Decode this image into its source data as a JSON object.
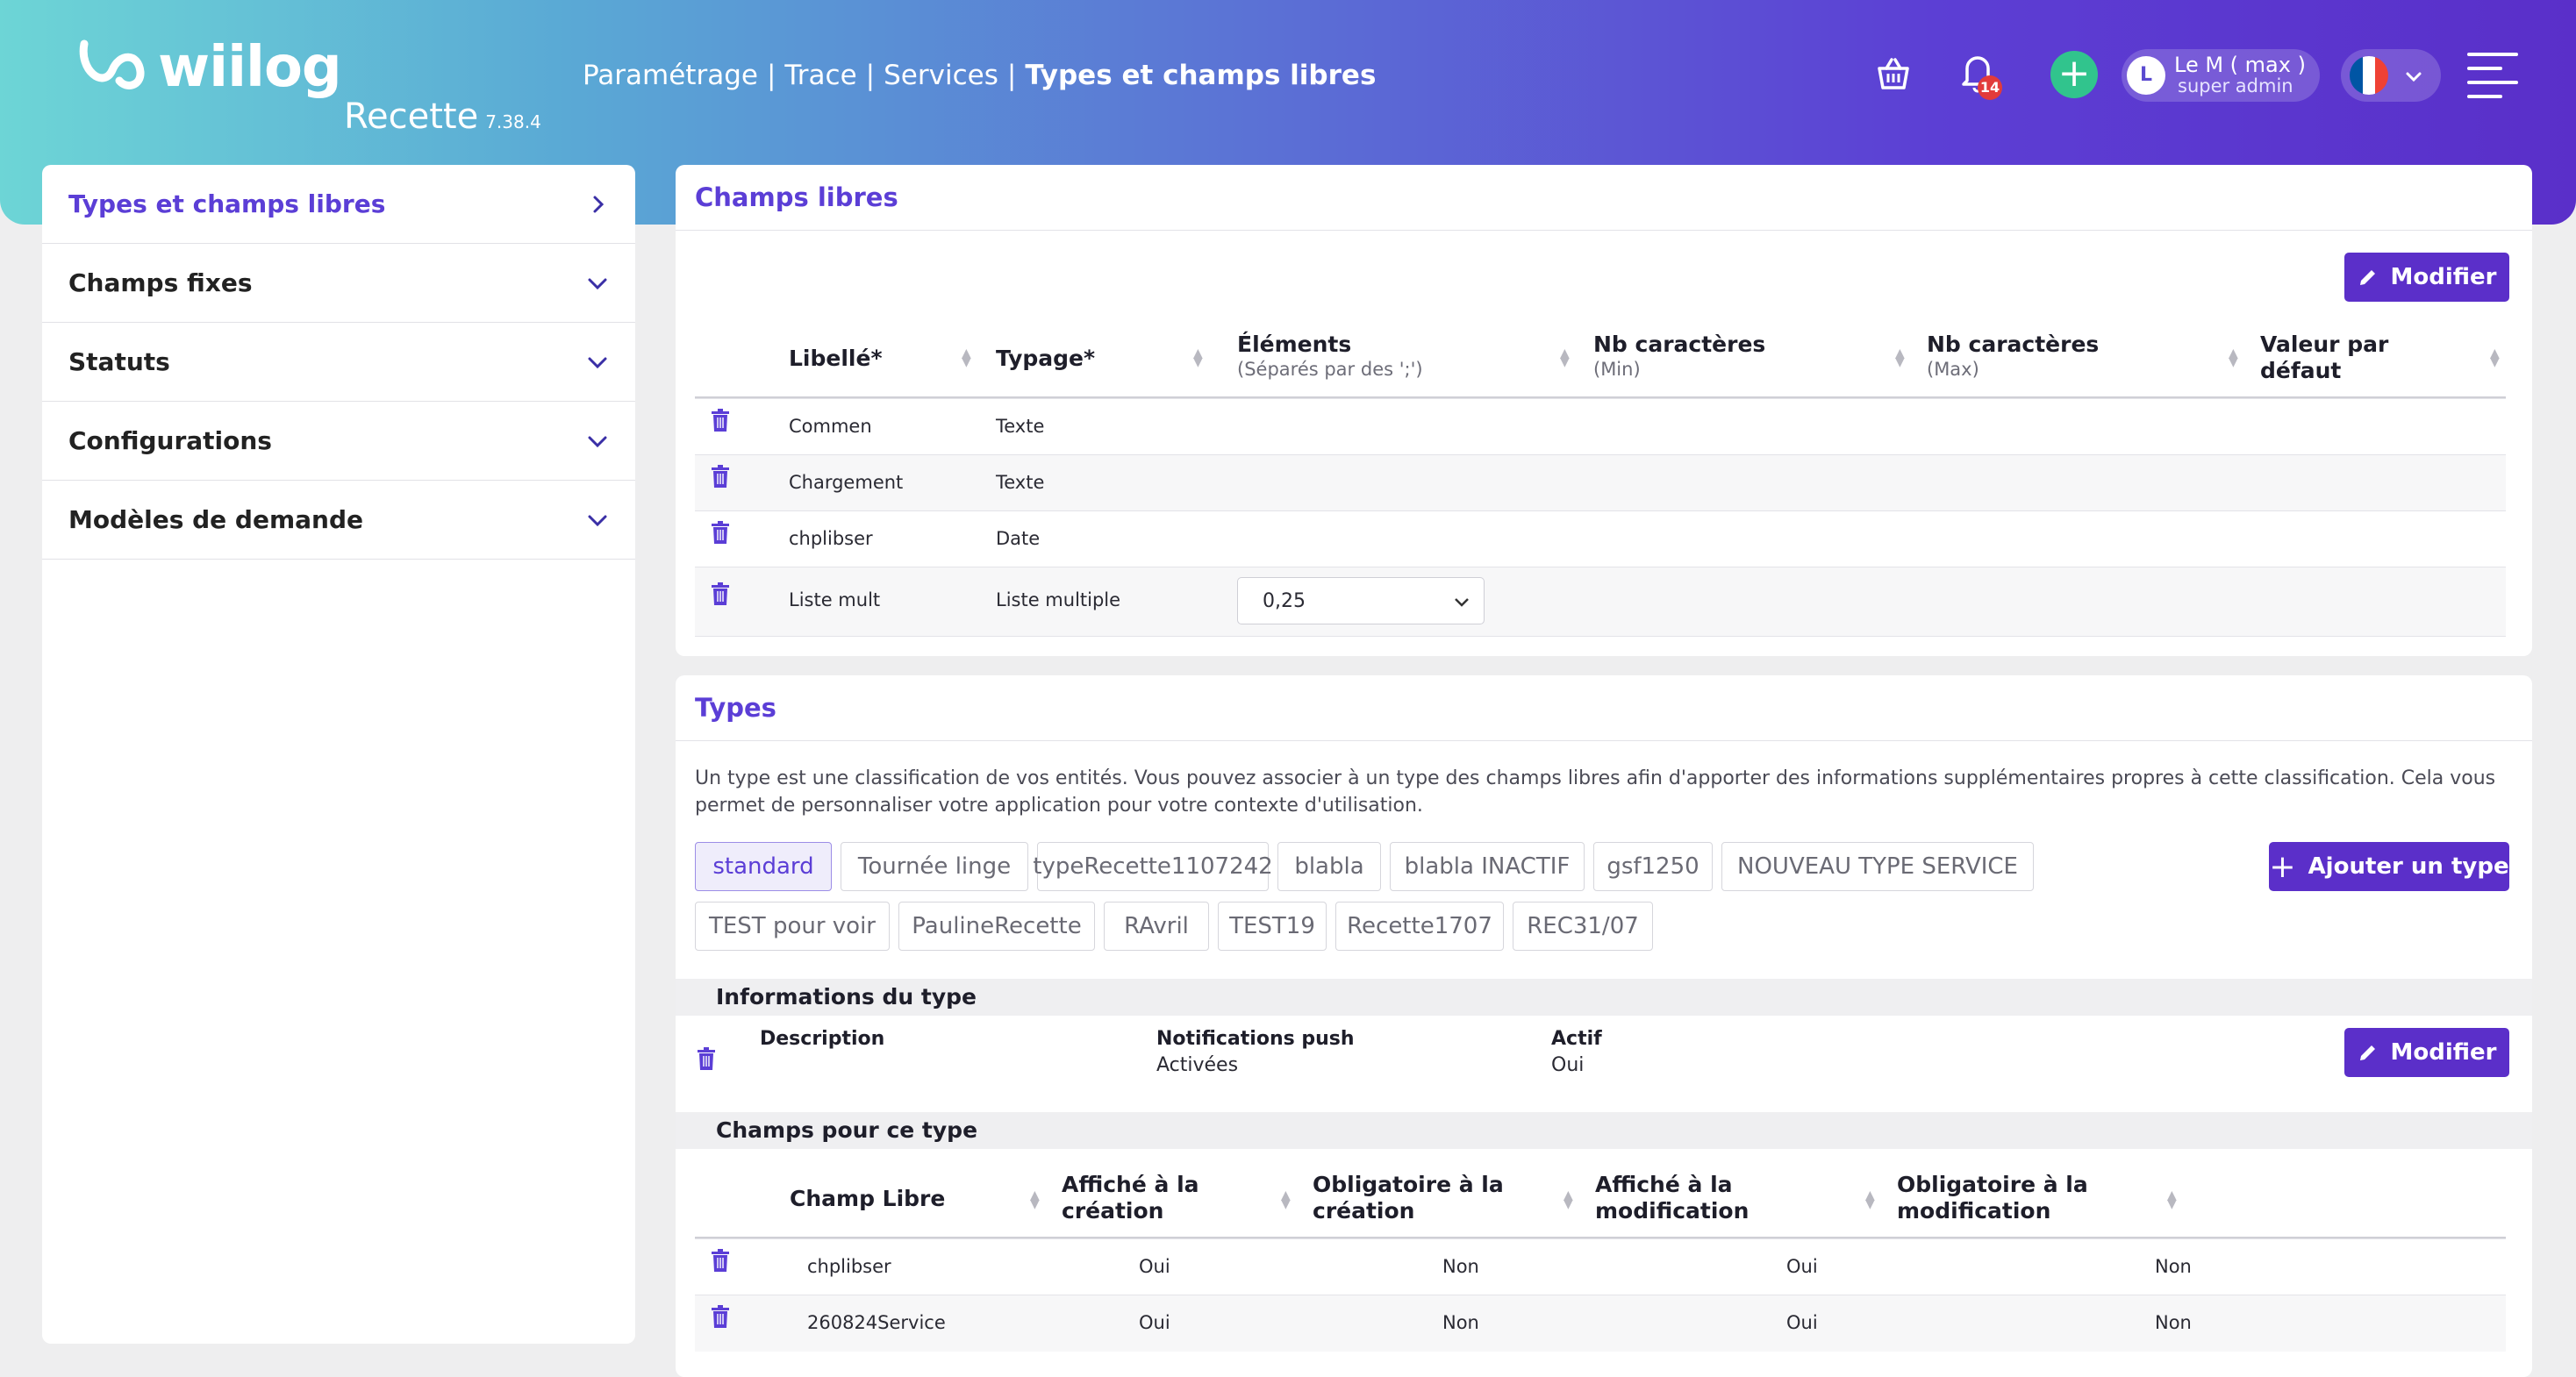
{
  "header": {
    "logo_text": "wiilog",
    "environment": "Recette",
    "version": "7.38.4",
    "breadcrumb": [
      "Paramétrage",
      "Trace",
      "Services",
      "Types et champs libres"
    ],
    "notification_count": "14",
    "user": {
      "initial": "L",
      "name": "Le M ( max )",
      "role": "super admin"
    },
    "language_flag_colors": [
      "#0055a4",
      "#ffffff",
      "#ef4135"
    ],
    "icons": [
      "basket-icon",
      "bell-icon",
      "plus-icon",
      "chevron-down-icon",
      "menu-icon"
    ]
  },
  "sidebar": {
    "items": [
      {
        "label": "Types et champs libres",
        "icon": "chevron-right-icon",
        "active": true
      },
      {
        "label": "Champs fixes",
        "icon": "chevron-down-icon"
      },
      {
        "label": "Statuts",
        "icon": "chevron-down-icon"
      },
      {
        "label": "Configurations",
        "icon": "chevron-down-icon"
      },
      {
        "label": "Modèles de demande",
        "icon": "chevron-down-icon"
      }
    ]
  },
  "champs_libres": {
    "title": "Champs libres",
    "modify_label": "Modifier",
    "columns": [
      {
        "label": "Libellé*",
        "sub": ""
      },
      {
        "label": "Typage*",
        "sub": ""
      },
      {
        "label": "Éléments",
        "sub": "(Séparés par des ';')"
      },
      {
        "label": "Nb caractères",
        "sub": "(Min)"
      },
      {
        "label": "Nb caractères",
        "sub": "(Max)"
      },
      {
        "label": "Valeur par défaut",
        "sub": ""
      }
    ],
    "rows": [
      {
        "libelle": "Commen",
        "typage": "Texte"
      },
      {
        "libelle": "Chargement",
        "typage": "Texte"
      },
      {
        "libelle": "chplibser",
        "typage": "Date"
      },
      {
        "libelle": "Liste mult",
        "typage": "Liste multiple",
        "elements": "0,25"
      }
    ]
  },
  "types": {
    "title": "Types",
    "description": "Un type est une classification de vos entités. Vous pouvez associer à un type des champs libres afin d'apporter des informations supplémentaires propres à cette classification. Cela vous permet de personnaliser votre application pour votre contexte d'utilisation.",
    "add_label": "Ajouter un type",
    "chips": [
      "standard",
      "Tournée linge",
      "typeRecette1107242",
      "blabla",
      "blabla INACTIF",
      "gsf1250",
      "NOUVEAU TYPE SERVICE",
      "TEST pour voir",
      "PaulineRecette",
      "RAvril",
      "TEST19",
      "Recette1707",
      "REC31/07"
    ],
    "selected_chip": "standard",
    "info": {
      "title": "Informations du type",
      "description_label": "Description",
      "description_value": "",
      "notifications_label": "Notifications push",
      "notifications_value": "Activées",
      "actif_label": "Actif",
      "actif_value": "Oui",
      "modify_label": "Modifier"
    },
    "fields": {
      "title": "Champs pour ce type",
      "columns": [
        "Champ Libre",
        "Affiché à la création",
        "Obligatoire à la création",
        "Affiché à la modification",
        "Obligatoire à la modification"
      ],
      "rows": [
        [
          "chplibser",
          "Oui",
          "Non",
          "Oui",
          "Non"
        ],
        [
          "260824Service",
          "Oui",
          "Non",
          "Oui",
          "Non"
        ]
      ]
    }
  }
}
